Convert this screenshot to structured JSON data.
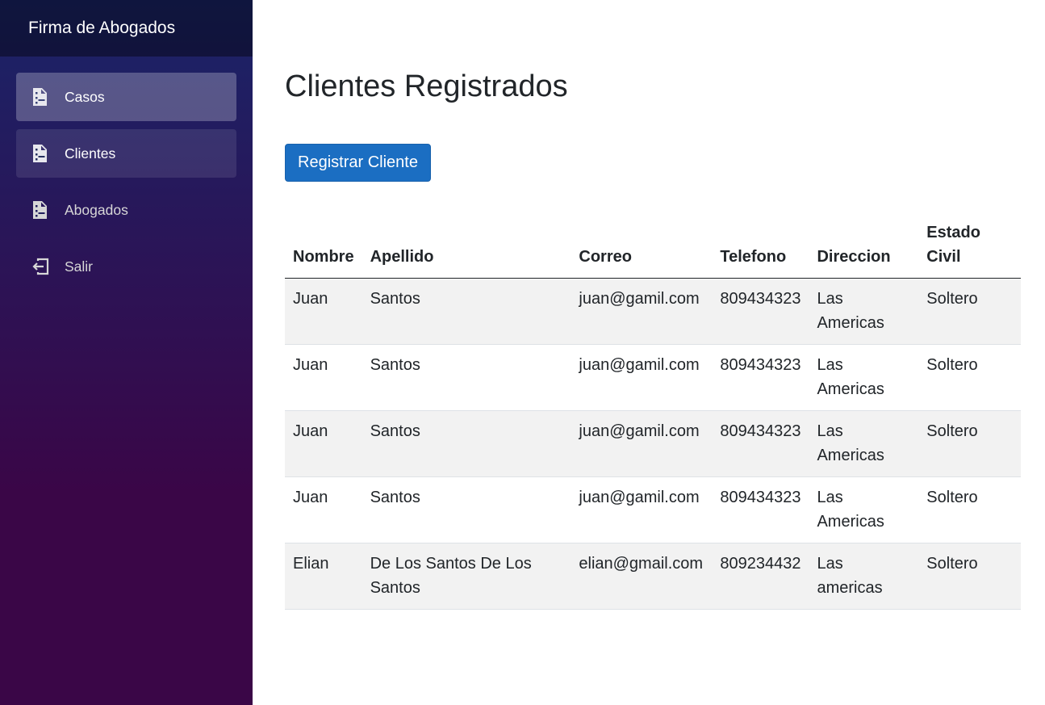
{
  "sidebar": {
    "brand": "Firma de Abogados",
    "items": [
      {
        "label": "Casos",
        "icon": "document-icon",
        "state": "active"
      },
      {
        "label": "Clientes",
        "icon": "document-icon",
        "state": "hover"
      },
      {
        "label": "Abogados",
        "icon": "document-icon",
        "state": "normal"
      },
      {
        "label": "Salir",
        "icon": "sign-out-icon",
        "state": "normal"
      }
    ]
  },
  "main": {
    "title": "Clientes Registrados",
    "register_button": "Registrar Cliente",
    "table": {
      "headers": [
        "Nombre",
        "Apellido",
        "Correo",
        "Telefono",
        "Direccion",
        "Estado Civil"
      ],
      "rows": [
        [
          "Juan",
          "Santos",
          "juan@gamil.com",
          "809434323",
          "Las Americas",
          "Soltero"
        ],
        [
          "Juan",
          "Santos",
          "juan@gamil.com",
          "809434323",
          "Las Americas",
          "Soltero"
        ],
        [
          "Juan",
          "Santos",
          "juan@gamil.com",
          "809434323",
          "Las Americas",
          "Soltero"
        ],
        [
          "Juan",
          "Santos",
          "juan@gamil.com",
          "809434323",
          "Las Americas",
          "Soltero"
        ],
        [
          "Elian",
          "De Los Santos De Los Santos",
          "elian@gmail.com",
          "809234432",
          "Las americas",
          "Soltero"
        ]
      ]
    }
  },
  "colors": {
    "sidebar_top": "#1a2468",
    "sidebar_bottom": "#3a0647",
    "primary": "#1b6ec2"
  }
}
